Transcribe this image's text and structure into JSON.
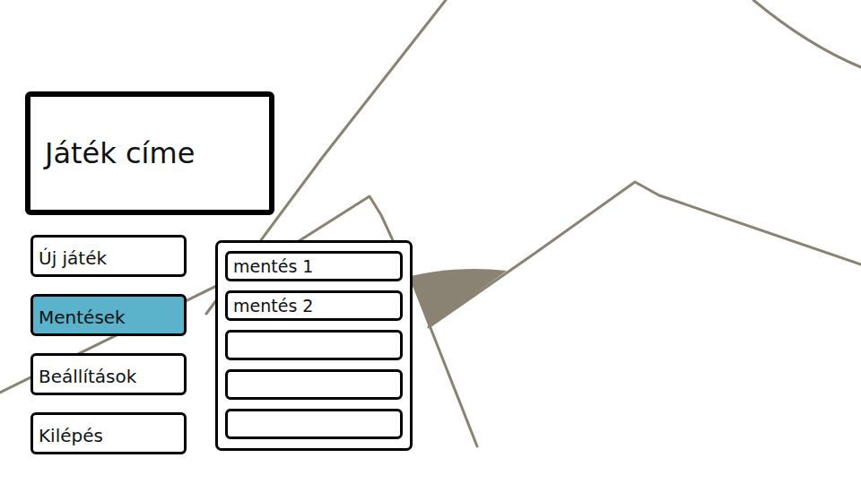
{
  "title": "Játék címe",
  "menu": [
    {
      "label": "Új játék",
      "selected": false
    },
    {
      "label": "Mentések",
      "selected": true
    },
    {
      "label": "Beállítások",
      "selected": false
    },
    {
      "label": "Kilépés",
      "selected": false
    }
  ],
  "saves": [
    {
      "label": "mentés 1"
    },
    {
      "label": "mentés 2"
    },
    {
      "label": ""
    },
    {
      "label": ""
    },
    {
      "label": ""
    }
  ]
}
